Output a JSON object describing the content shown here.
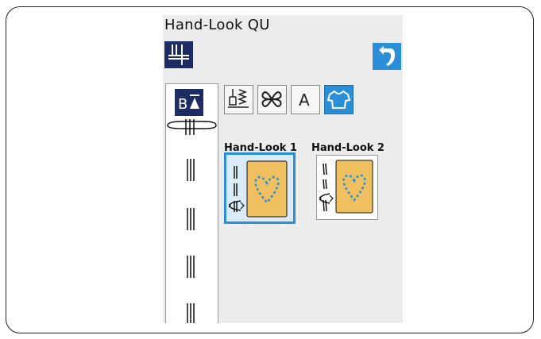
{
  "window": {
    "title": "Hand-Look QU"
  },
  "toolbar": {
    "mode_icon": "foot-pressure-icon",
    "back_icon": "return-arrow-icon"
  },
  "left_column": {
    "bt_label": "B",
    "stitches": [
      "buttonhole-stitch-icon",
      "straight-stitch-icon",
      "straight-stitch-icon",
      "straight-stitch-icon",
      "straight-stitch-icon"
    ]
  },
  "categories": [
    {
      "name": "utility-stitch",
      "icon": "utility-stitch-icon"
    },
    {
      "name": "decorative-stitch",
      "icon": "decorative-stitch-icon"
    },
    {
      "name": "monogram",
      "icon": "monogram-icon",
      "label": "A"
    },
    {
      "name": "quilt",
      "icon": "shirt-icon",
      "active": true
    }
  ],
  "patterns": [
    {
      "label": "Hand-Look 1",
      "selected": true
    },
    {
      "label": "Hand-Look 2",
      "selected": false
    }
  ],
  "colors": {
    "accent": "#2a8fd6",
    "navy": "#1e2c66",
    "swatch": "#f0c060"
  }
}
